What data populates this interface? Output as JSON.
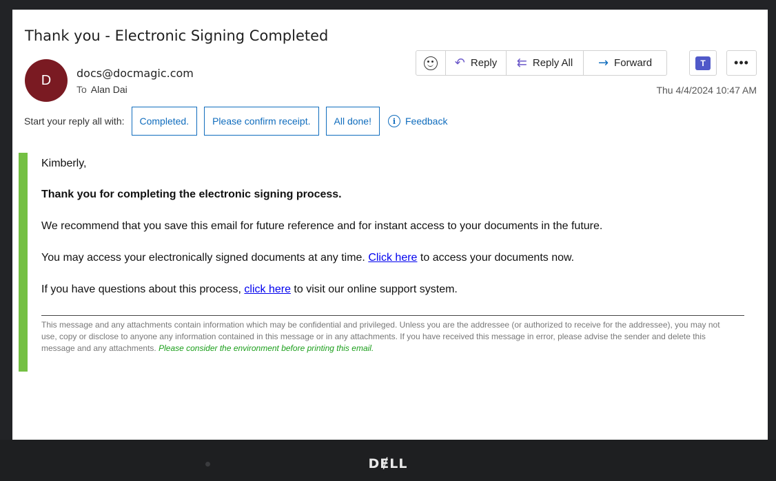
{
  "email": {
    "subject": "Thank you - Electronic Signing Completed",
    "avatar_initial": "D",
    "sender": "docs@docmagic.com",
    "to_label": "To",
    "to_name": "Alan Dai",
    "timestamp": "Thu 4/4/2024 10:47 AM"
  },
  "actions": {
    "emoji_icon": "smiley-icon",
    "reply_label": "Reply",
    "reply_all_label": "Reply All",
    "forward_label": "Forward",
    "teams_icon": "teams-icon",
    "more_icon": "more-icon"
  },
  "suggestions": {
    "label": "Start your reply all with:",
    "chips": [
      "Completed.",
      "Please confirm receipt.",
      "All done!"
    ],
    "feedback_label": "Feedback"
  },
  "body": {
    "greeting": "Kimberly,",
    "bold_line": "Thank you for completing the electronic signing process.",
    "para1": "We recommend that you save this email for future reference and for instant access to your documents in the future.",
    "para2_before": "You may access your electronically signed documents at any time. ",
    "para2_link": "Click here",
    "para2_after": " to access your documents now.",
    "para3_before": "If you have questions about this process, ",
    "para3_link": "click here",
    "para3_after": " to visit our online support system."
  },
  "disclaimer": {
    "text": "This message and any attachments contain information which may be confidential and privileged. Unless you are the addressee (or authorized to receive for the addressee), you may not use, copy or disclose to anyone any information contained in this message or in any attachments. If you have received this message in error, please advise the sender and delete this message and any attachments. ",
    "environment_note": "Please consider the environment before printing this email."
  },
  "device": {
    "brand": "DɆLL"
  },
  "colors": {
    "accent_blue": "#0f6cbd",
    "avatar_bg": "#7a1a22",
    "quote_bar": "#74c043",
    "environment_green": "#1a9e1a"
  }
}
